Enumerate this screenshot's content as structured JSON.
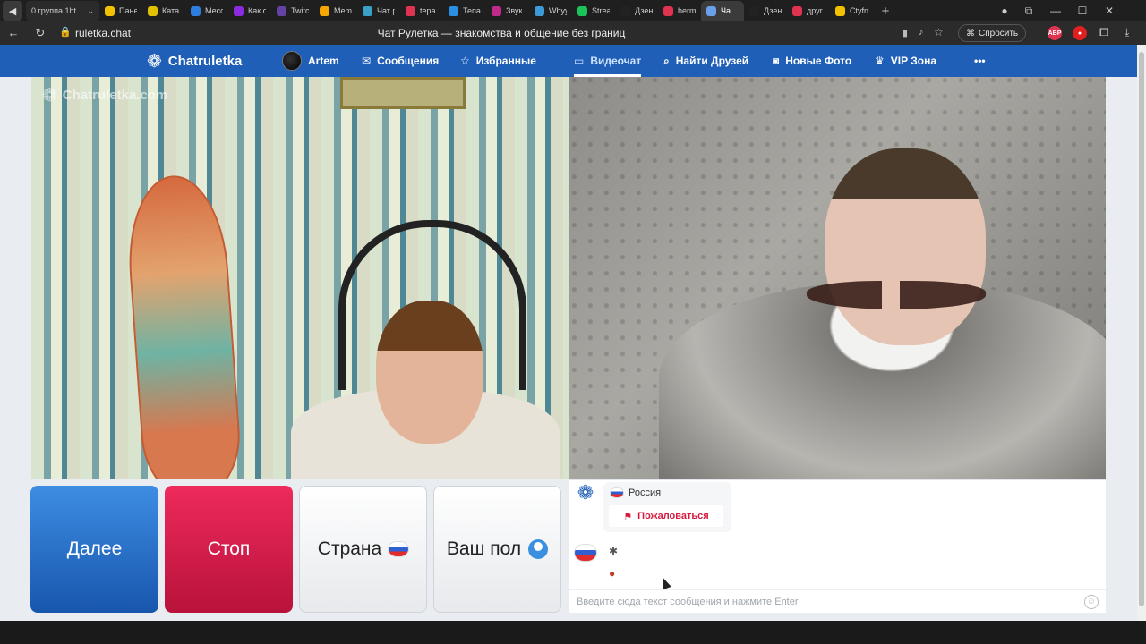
{
  "browser": {
    "first_tab": "0  группа 1ht",
    "tabs": [
      {
        "label": "Пане",
        "color": "#f2c200"
      },
      {
        "label": "Катал",
        "color": "#e0c000"
      },
      {
        "label": "Месс",
        "color": "#2e7de0"
      },
      {
        "label": "Как о",
        "color": "#8a2be2"
      },
      {
        "label": "Twitc",
        "color": "#6441a5"
      },
      {
        "label": "Mem",
        "color": "#f7a800"
      },
      {
        "label": "Чат р",
        "color": "#3aa0c8"
      },
      {
        "label": "tepa",
        "color": "#e0334f"
      },
      {
        "label": "Тепа",
        "color": "#2a8fe0"
      },
      {
        "label": "Звук",
        "color": "#c02a8a"
      },
      {
        "label": "Whyy",
        "color": "#3c9bd6"
      },
      {
        "label": "Strea",
        "color": "#1bc45b"
      },
      {
        "label": "Дзен",
        "color": "#222222"
      },
      {
        "label": "herm",
        "color": "#e0334f"
      },
      {
        "label": "Ча",
        "color": "#6aa0e8",
        "active": true
      },
      {
        "label": "Дзен",
        "color": "#222222"
      },
      {
        "label": "друг",
        "color": "#e0334f"
      },
      {
        "label": "Ctyfn",
        "color": "#f2c200"
      }
    ],
    "url": "ruletka.chat",
    "page_title": "Чат Рулетка — знакомства и общение без границ",
    "ask_label": "Спросить",
    "ext_abp": "ABP"
  },
  "site_nav": {
    "brand": "Chatruletka",
    "user": "Artem",
    "messages": "Сообщения",
    "favorites": "Избранные",
    "videochat": "Видеочат",
    "find_friends": "Найти Друзей",
    "new_photos": "Новые Фото",
    "vip": "VIP Зона",
    "more": "•••"
  },
  "video": {
    "watermark": "Chatruletka.com"
  },
  "controls": {
    "next": "Далее",
    "stop": "Стоп",
    "country": "Страна",
    "gender": "Ваш пол"
  },
  "chat": {
    "country": "Россия",
    "report": "Пожаловаться",
    "input_placeholder": "Введите сюда текст сообщения и нажмите Enter"
  },
  "colors": {
    "nav_blue": "#1f5fb8",
    "next_blue": "#1856ad",
    "stop_red": "#b8123b",
    "report_red": "#d7193f"
  }
}
